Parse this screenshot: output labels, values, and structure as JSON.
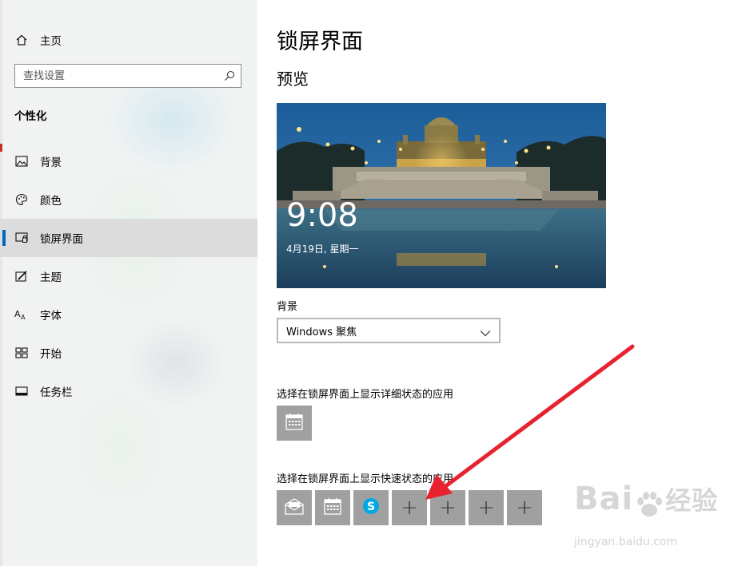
{
  "sidebar": {
    "home_label": "主页",
    "search_placeholder": "查找设置",
    "section_title": "个性化",
    "items": [
      {
        "label": "背景",
        "icon": "image-icon"
      },
      {
        "label": "颜色",
        "icon": "palette-icon"
      },
      {
        "label": "锁屏界面",
        "icon": "lock-screen-icon",
        "selected": true
      },
      {
        "label": "主题",
        "icon": "theme-icon"
      },
      {
        "label": "字体",
        "icon": "font-icon"
      },
      {
        "label": "开始",
        "icon": "start-icon"
      },
      {
        "label": "任务栏",
        "icon": "taskbar-icon"
      }
    ]
  },
  "main": {
    "title": "锁屏界面",
    "preview_label": "预览",
    "preview": {
      "time": "9:08",
      "date": "4月19日, 星期一"
    },
    "background_label": "背景",
    "background_value": "Windows 聚焦",
    "detail_status_label": "选择在锁屏界面上显示详细状态的应用",
    "quick_status_label": "选择在锁屏界面上显示快速状态的应用",
    "detail_apps": [
      {
        "icon": "calendar-icon"
      }
    ],
    "quick_apps": [
      {
        "icon": "mail-icon"
      },
      {
        "icon": "calendar-icon"
      },
      {
        "icon": "skype-icon"
      },
      {
        "icon": "add-icon",
        "symbol": "+"
      },
      {
        "icon": "add-icon",
        "symbol": "+"
      },
      {
        "icon": "add-icon",
        "symbol": "+"
      },
      {
        "icon": "add-icon",
        "symbol": "+"
      }
    ]
  },
  "annotation": {
    "arrow_color": "#e8222f"
  },
  "watermark": {
    "brand": "Bai",
    "brand_cn": "经验",
    "url": "jingyan.baidu.com"
  },
  "colors": {
    "accent": "#0067c0",
    "tile": "#a0a0a0",
    "selected_bg": "#dcdcdc"
  }
}
